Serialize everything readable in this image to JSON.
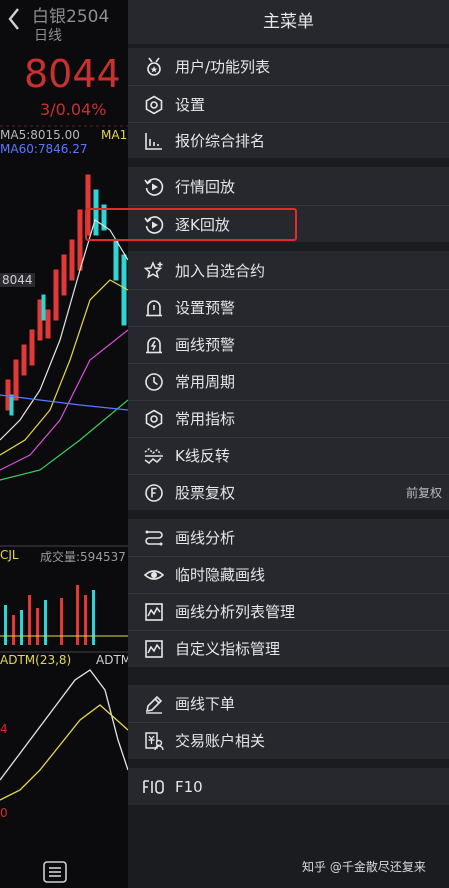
{
  "chart": {
    "title": "白银2504",
    "subtitle": "日线",
    "price": "8044",
    "change": "3/0.04%",
    "ma5": "MA5:8015.00",
    "ma_short": "MA1",
    "ma60": "MA60:7846.27",
    "price_tag": "8044",
    "vol_label": "CJL",
    "vol_value": "成交量:594537",
    "adtm1": "ADTM(23,8)",
    "adtm2": "ADTM",
    "tick_4": "4",
    "tick_0": "0",
    "colors": {
      "red": "#e23838",
      "cyan": "#2fd4d4",
      "blue": "#5a78ff",
      "yellow": "#e6d84a",
      "gold": "#d9a14b"
    }
  },
  "menu": {
    "title": "主菜单",
    "items": [
      {
        "label": "用户/功能列表",
        "icon": "medal-icon"
      },
      {
        "label": "设置",
        "icon": "hexagon-gear-icon"
      },
      {
        "label": "报价综合排名",
        "icon": "ranking-chart-icon"
      },
      {
        "label": "行情回放",
        "icon": "replay-icon"
      },
      {
        "label": "逐K回放",
        "icon": "play-replay-icon"
      },
      {
        "label": "加入自选合约",
        "icon": "star-add-icon"
      },
      {
        "label": "设置预警",
        "icon": "alarm-icon"
      },
      {
        "label": "画线预警",
        "icon": "alarm-bolt-icon"
      },
      {
        "label": "常用周期",
        "icon": "clock-icon"
      },
      {
        "label": "常用指标",
        "icon": "hexagon-gear-icon"
      },
      {
        "label": "K线反转",
        "icon": "flip-icon"
      },
      {
        "label": "股票复权",
        "icon": "f-circle-icon",
        "right": "前复权"
      },
      {
        "label": "画线分析",
        "icon": "path-icon"
      },
      {
        "label": "临时隐藏画线",
        "icon": "eye-icon"
      },
      {
        "label": "画线分析列表管理",
        "icon": "chart-box-icon"
      },
      {
        "label": "自定义指标管理",
        "icon": "chart-box-icon"
      },
      {
        "label": "画线下单",
        "icon": "pencil-icon"
      },
      {
        "label": "交易账户相关",
        "icon": "account-icon"
      },
      {
        "label": "F10",
        "icon": "f10-icon"
      }
    ]
  },
  "watermark": "知乎 @千金散尽还复来"
}
